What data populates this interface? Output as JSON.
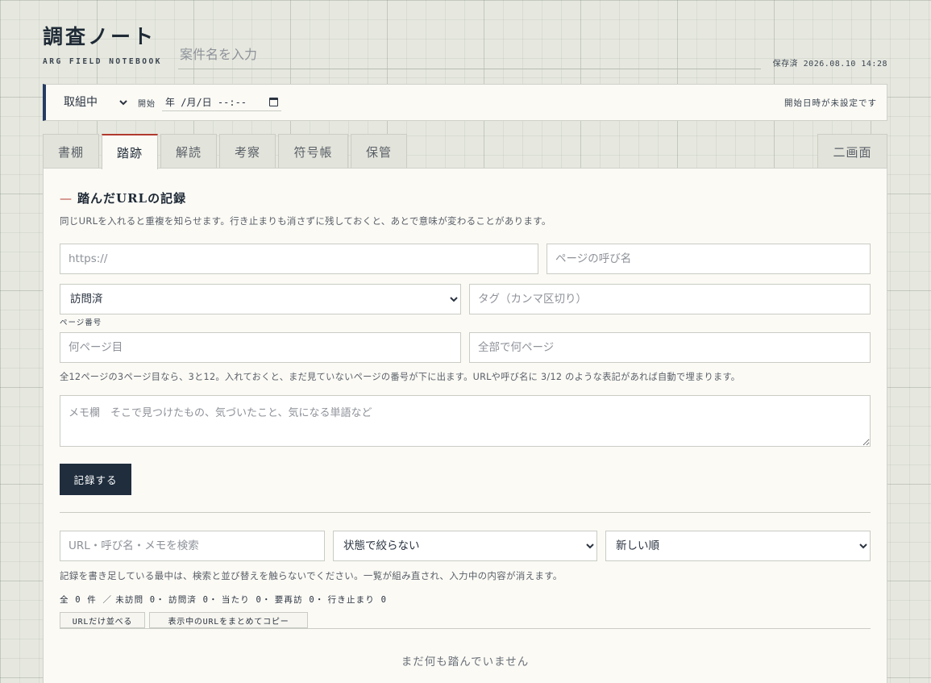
{
  "header": {
    "title": "調査ノート",
    "subtitle": "ARG FIELD NOTEBOOK",
    "case_placeholder": "案件名を入力",
    "saved_status": "保存済 2026.08.10 14:28"
  },
  "statusbar": {
    "status_value": "取組中",
    "start_label": "開始",
    "date_placeholder": "年 /月/日 --:--",
    "start_note": "開始日時が未設定です"
  },
  "tabs": [
    "書棚",
    "踏跡",
    "解読",
    "考察",
    "符号帳",
    "保管"
  ],
  "active_tab": "踏跡",
  "dual_view_label": "二画面",
  "section": {
    "title": "踏んだURLの記録",
    "description": "同じURLを入れると重複を知らせます。行き止まりも消さずに残しておくと、あとで意味が変わることがあります。"
  },
  "form": {
    "url_placeholder": "https://",
    "page_name_placeholder": "ページの呼び名",
    "visit_status_value": "訪問済",
    "tags_placeholder": "タグ（カンマ区切り）",
    "page_number_label": "ページ番号",
    "page_index_placeholder": "何ページ目",
    "page_total_placeholder": "全部で何ページ",
    "page_hint": "全12ページの3ページ目なら、3と12。入れておくと、まだ見ていないページの番号が下に出ます。URLや呼び名に 3/12 のような表記があれば自動で埋まります。",
    "memo_placeholder": "メモ欄　そこで見つけたもの、気づいたこと、気になる単語など",
    "submit_label": "記録する"
  },
  "list": {
    "search_placeholder": "URL・呼び名・メモを検索",
    "filter_value": "状態で絞らない",
    "sort_value": "新しい順",
    "warning": "記録を書き足している最中は、検索と並び替えを触らないでください。一覧が組み直され、入力中の内容が消えます。",
    "counts": [
      "全 0 件 ／",
      "未訪問 0・",
      "訪問済 0・",
      "当たり 0・",
      "要再訪 0・",
      "行き止まり 0"
    ],
    "url_only_label": "URLだけ並べる",
    "copy_label": "表示中のURLをまとめてコピー",
    "empty_message": "まだ何も踏んでいません"
  }
}
